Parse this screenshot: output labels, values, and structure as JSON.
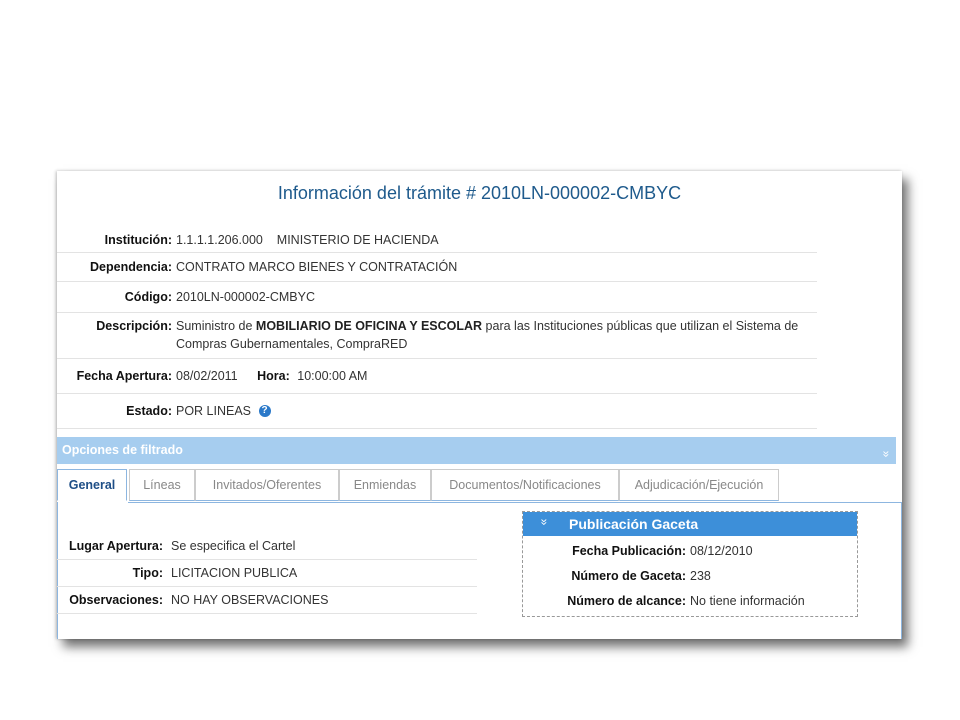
{
  "title": "Información del trámite # 2010LN-000002-CMBYC",
  "info": {
    "institucion_label": "Institución:",
    "institucion": "1.1.1.1.206.000    MINISTERIO DE HACIENDA",
    "dependencia_label": "Dependencia:",
    "dependencia": "CONTRATO MARCO BIENES Y CONTRATACIÓN",
    "codigo_label": "Código:",
    "codigo": "2010LN-000002-CMBYC",
    "descripcion_label": "Descripción:",
    "descripcion_pre": "Suministro de ",
    "descripcion_bold": "MOBILIARIO DE OFICINA Y ESCOLAR",
    "descripcion_post": " para las Instituciones públicas que utilizan el Sistema de Compras Gubernamentales, CompraRED",
    "fecha_apertura_label": "Fecha Apertura:",
    "fecha_apertura": "08/02/2011",
    "hora_label": "Hora:",
    "hora": "10:00:00 AM",
    "estado_label": "Estado:",
    "estado": "POR LINEAS"
  },
  "filter": {
    "label": "Opciones de filtrado",
    "chevron": "»"
  },
  "tabs": [
    {
      "label": "General"
    },
    {
      "label": "Líneas"
    },
    {
      "label": "Invitados/Oferentes"
    },
    {
      "label": "Enmiendas"
    },
    {
      "label": "Documentos/Notificaciones"
    },
    {
      "label": "Adjudicación/Ejecución"
    }
  ],
  "general": {
    "lugar_label": "Lugar Apertura:",
    "lugar": "Se especifica el Cartel",
    "tipo_label": "Tipo:",
    "tipo": "LICITACION PUBLICA",
    "obs_label": "Observaciones:",
    "obs": "NO HAY OBSERVACIONES"
  },
  "gaceta": {
    "title": "Publicación Gaceta",
    "chevron": "»",
    "fecha_label": "Fecha Publicación:",
    "fecha": "08/12/2010",
    "numero_label": "Número de Gaceta:",
    "numero": "238",
    "alcance_label": "Número de alcance:",
    "alcance": "No tiene información"
  },
  "colors": {
    "title": "#1e5a8c",
    "filter_bar": "#a6cdef",
    "gaceta_header": "#3d8fd9",
    "help_icon": "#2b79c9"
  }
}
